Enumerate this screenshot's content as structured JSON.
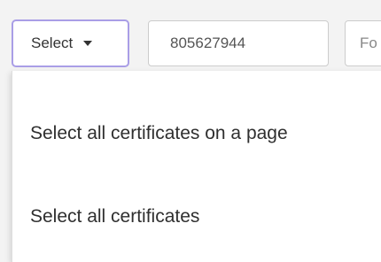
{
  "toolbar": {
    "select_label": "Select",
    "id_input_value": "805627944",
    "next_input_placeholder": "Fo"
  },
  "dropdown": {
    "items": [
      {
        "label": "Select all certificates on a page"
      },
      {
        "label": "Select all certificates"
      }
    ]
  }
}
